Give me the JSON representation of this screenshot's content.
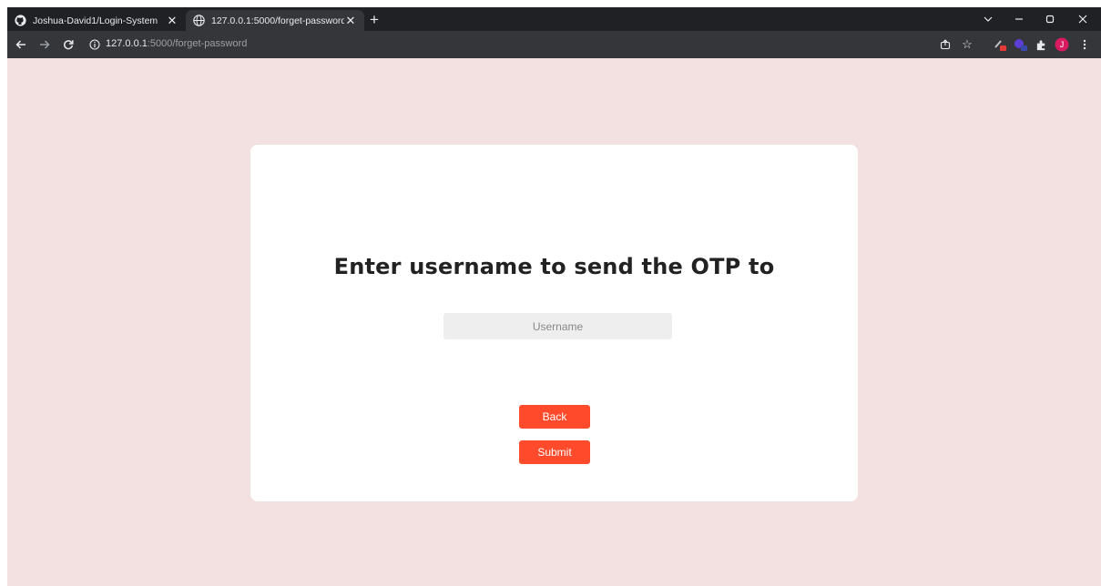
{
  "browser": {
    "tabs": [
      {
        "title": "Joshua-David1/Login-System",
        "active": false,
        "icon": "github-icon"
      },
      {
        "title": "127.0.0.1:5000/forget-password",
        "active": true,
        "icon": "globe-icon"
      }
    ],
    "url": {
      "host": "127.0.0.1",
      "rest": ":5000/forget-password"
    },
    "profile_initial": "J"
  },
  "page": {
    "heading": "Enter username to send the OTP to",
    "username_placeholder": "Username",
    "back_label": "Back",
    "submit_label": "Submit"
  },
  "colors": {
    "page_bg": "#f3e0e0",
    "card_bg": "#ffffff",
    "accent": "#ff4b2b",
    "input_bg": "#eeeeee"
  }
}
